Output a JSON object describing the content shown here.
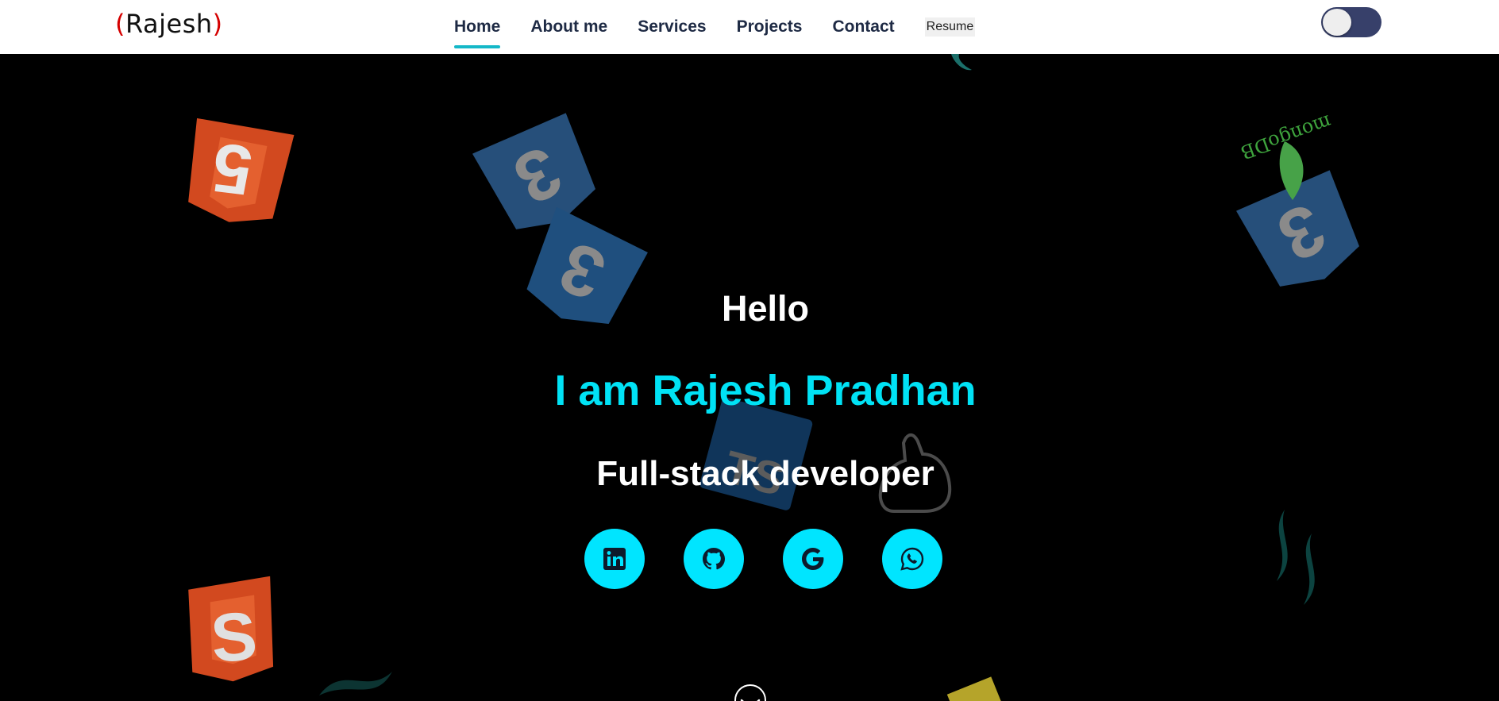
{
  "logo": {
    "open_paren": "(",
    "text": "Rajesh",
    "close_paren": ")"
  },
  "nav": {
    "items": [
      {
        "label": "Home",
        "active": true
      },
      {
        "label": "About me"
      },
      {
        "label": "Services"
      },
      {
        "label": "Projects"
      },
      {
        "label": "Contact"
      }
    ],
    "resume_label": "Resume"
  },
  "theme_toggle": {
    "state": "off"
  },
  "hero": {
    "greeting": "Hello",
    "name_line": "I am Rajesh Pradhan",
    "role": "Full-stack developer"
  },
  "social_links": [
    {
      "icon": "linkedin-icon"
    },
    {
      "icon": "github-icon"
    },
    {
      "icon": "google-icon"
    },
    {
      "icon": "whatsapp-icon"
    }
  ],
  "background_icons": {
    "mongodb_label": "mongoDB",
    "typescript_label": "TS"
  },
  "colors": {
    "accent": "#00e5ff",
    "nav_text": "#1e2a44",
    "active_underline": "#14b8c8",
    "toggle_track": "#37406a",
    "logo_paren": "#d50000"
  }
}
